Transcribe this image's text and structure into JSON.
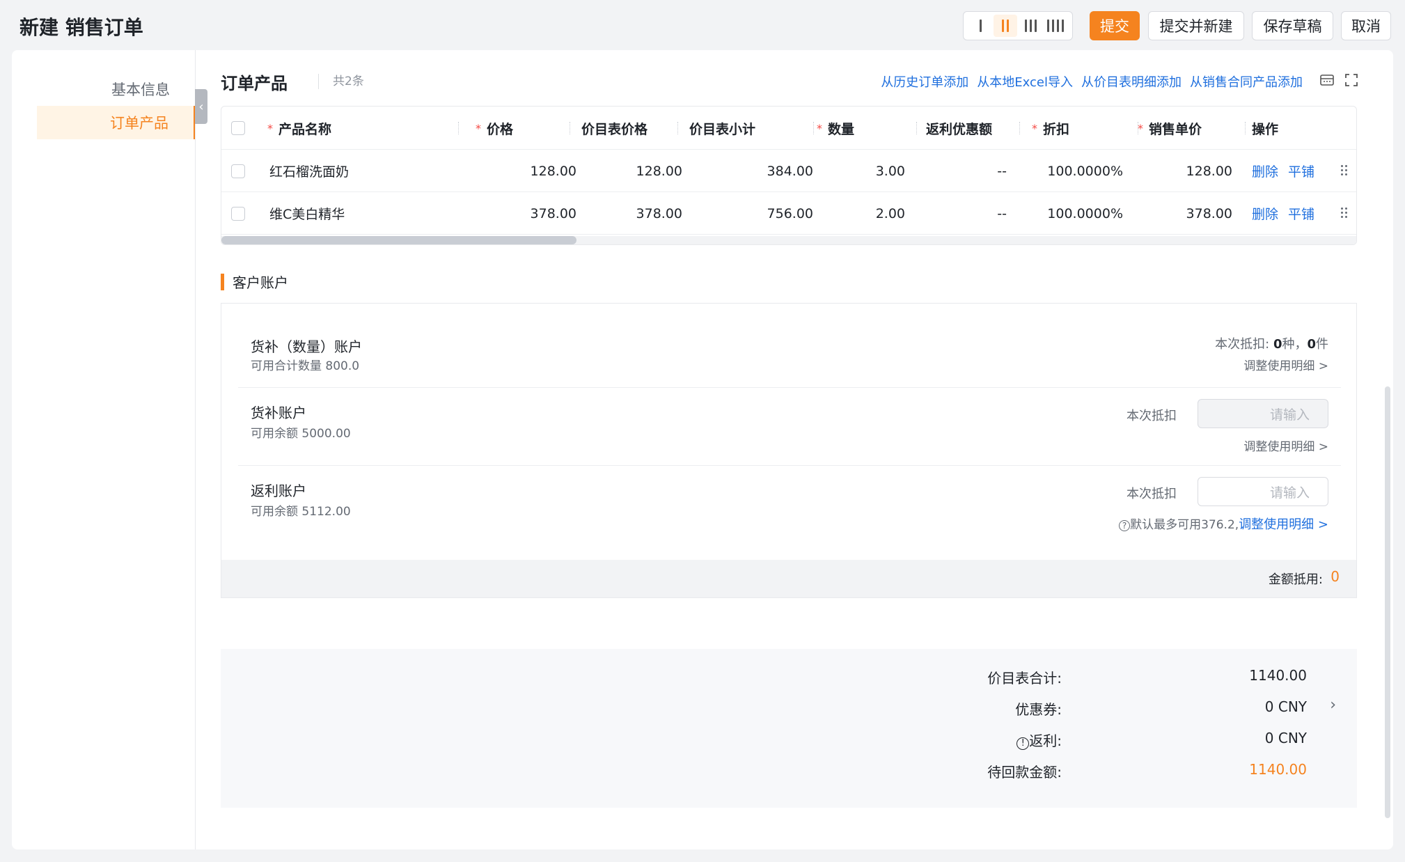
{
  "page": {
    "title": "新建 销售订单"
  },
  "toolbar": {
    "submit_label": "提交",
    "submit_new_label": "提交并新建",
    "save_draft_label": "保存草稿",
    "cancel_label": "取消"
  },
  "sidebar": {
    "items": [
      {
        "label": "基本信息"
      },
      {
        "label": "订单产品"
      }
    ]
  },
  "order_products": {
    "title": "订单产品",
    "count": "共2条",
    "actions": [
      "从历史订单添加",
      "从本地Excel导入",
      "从价目表明细添加",
      "从销售合同产品添加"
    ],
    "columns": [
      "产品名称",
      "价格",
      "价目表价格",
      "价目表小计",
      "数量",
      "返利优惠额",
      "折扣",
      "销售单价",
      "操作"
    ],
    "rows": [
      {
        "name": "红石榴洗面奶",
        "price": "128.00",
        "list_price": "128.00",
        "list_subtotal": "384.00",
        "qty": "3.00",
        "rebate": "--",
        "discount": "100.0000%",
        "unit_price": "128.00",
        "op1": "删除",
        "op2": "平铺"
      },
      {
        "name": "维C美白精华",
        "price": "378.00",
        "list_price": "378.00",
        "list_subtotal": "756.00",
        "qty": "2.00",
        "rebate": "--",
        "discount": "100.0000%",
        "unit_price": "378.00",
        "op1": "删除",
        "op2": "平铺"
      }
    ]
  },
  "customer_account": {
    "title": "客户账户",
    "accounts": [
      {
        "name": "货补（数量）账户",
        "sub": "可用合计数量 800.0",
        "deduct_prefix": "本次抵扣: ",
        "kinds": "0",
        "kinds_unit": "种，",
        "items": "0",
        "items_unit": "件",
        "link": "调整使用明细 >"
      },
      {
        "name": "货补账户",
        "sub": "可用余额 5000.00",
        "deduct_label": "本次抵扣",
        "placeholder": "请输入",
        "link": "调整使用明细 >"
      },
      {
        "name": "返利账户",
        "sub": "可用余额 5112.00",
        "deduct_label": "本次抵扣",
        "placeholder": "请输入",
        "hint": "默认最多可用376.2,",
        "link": "调整使用明细 >"
      }
    ],
    "footer_label": "金额抵用:",
    "footer_value": "0"
  },
  "summary": {
    "rows": [
      {
        "label": "价目表合计:",
        "value": "1140.00"
      },
      {
        "label": "优惠券:",
        "value": "0 CNY"
      },
      {
        "label": "返利:",
        "value": "0 CNY"
      },
      {
        "label": "待回款金额:",
        "value": "1140.00"
      }
    ]
  },
  "colors": {
    "accent": "#f5831f",
    "link": "#1f6fde",
    "required": "#f54a45"
  },
  "icons": [
    "layout-1-col-icon",
    "layout-2-col-icon",
    "layout-3-col-icon",
    "layout-4-col-icon",
    "collapse-icon",
    "column-settings-icon",
    "fullscreen-icon",
    "drag-handle-icon",
    "info-icon",
    "chevron-right-icon"
  ]
}
